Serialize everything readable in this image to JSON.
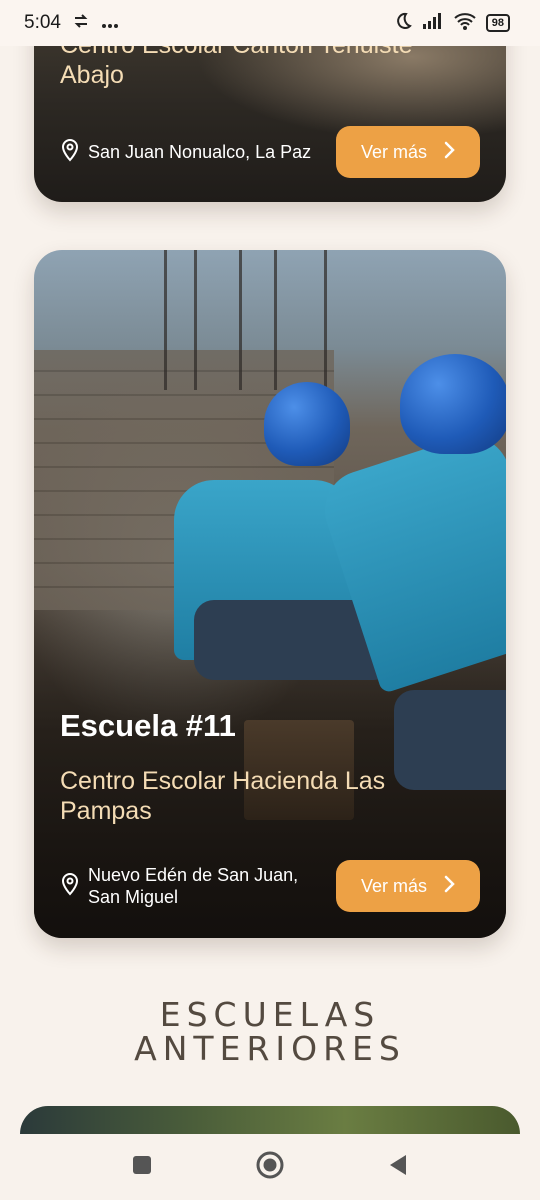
{
  "status_bar": {
    "time": "5:04",
    "battery": "98",
    "icons": [
      "sync-icon",
      "more-icon",
      "moon-icon",
      "signal-icon",
      "wifi-icon",
      "battery-icon"
    ]
  },
  "cards": [
    {
      "title": "Centro Escolar Cantón Tehuiste Abajo",
      "location": "San Juan Nonualco, La Paz",
      "button_label": "Ver más"
    },
    {
      "number": "Escuela #11",
      "title": "Centro Escolar Hacienda Las Pampas",
      "location": "Nuevo Edén de San Juan, San Miguel",
      "button_label": "Ver más"
    }
  ],
  "section": {
    "heading_line1": "ESCUELAS",
    "heading_line2": "ANTERIORES"
  },
  "colors": {
    "background": "#f8f2ec",
    "accent": "#eda145",
    "title_text": "#f4dcb5",
    "heading_text": "#544a40"
  }
}
